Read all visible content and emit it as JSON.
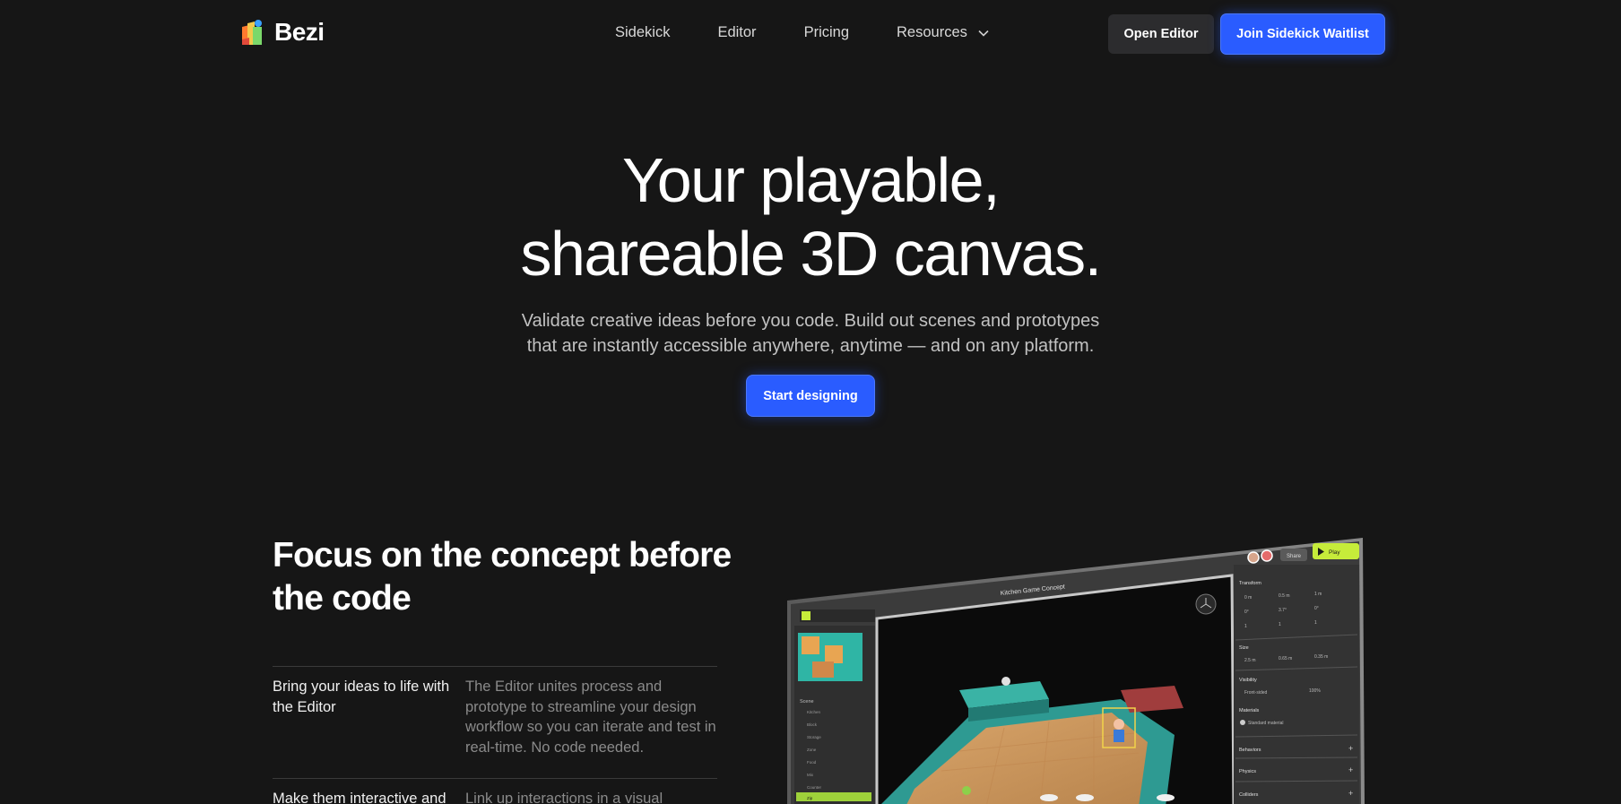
{
  "nav": {
    "brand": "Bezi",
    "links": [
      "Sidekick",
      "Editor",
      "Pricing",
      "Resources"
    ],
    "open_editor": "Open Editor",
    "join_waitlist": "Join Sidekick Waitlist"
  },
  "hero": {
    "title_line1": "Your playable,",
    "title_line2": "shareable 3D canvas.",
    "subtitle_line1": "Validate creative ideas before you code. Build out scenes and prototypes",
    "subtitle_line2": "that are instantly accessible anywhere, anytime — and on any platform.",
    "cta": "Start designing"
  },
  "features": {
    "title": "Focus on the concept before the code",
    "rows": [
      {
        "title": "Bring your ideas to life with the Editor",
        "desc": "The Editor unites process and prototype to streamline your design workflow so you can iterate and test in real-time. No code needed."
      },
      {
        "title": "Make them interactive and",
        "desc": "Link up interactions in a visual"
      }
    ]
  },
  "mockup": {
    "window_title": "Kitchen Game Concept",
    "share": "Share",
    "play": "Play",
    "panel": {
      "transform": "Transform",
      "size": "Size",
      "visibility": "Visibility",
      "visibility_value": "Front-sided",
      "opacity": "100%",
      "materials": "Materials",
      "material_value": "Standard material",
      "behaviors": "Behaviors",
      "physics": "Physics",
      "colliders": "Colliders",
      "x_pos": "0 m",
      "y_pos": "0.5 m",
      "z_pos": "1 m",
      "x_rot": "0°",
      "y_rot": "3.7°",
      "z_rot": "0°",
      "x_scale": "1",
      "y_scale": "1",
      "z_scale": "1",
      "w": "2.5 m",
      "h": "0.65 m",
      "d": "0.35 m"
    },
    "scene": {
      "header": "Scene",
      "items": [
        "Kitchen",
        "Block",
        "Storage",
        "Zone",
        "Food",
        "Mix",
        "Counter",
        "Zip"
      ]
    }
  },
  "colors": {
    "background": "#161616",
    "accent": "#2a5cff",
    "button_dark": "#2c2c2e",
    "play_green": "#c6ec3a"
  }
}
